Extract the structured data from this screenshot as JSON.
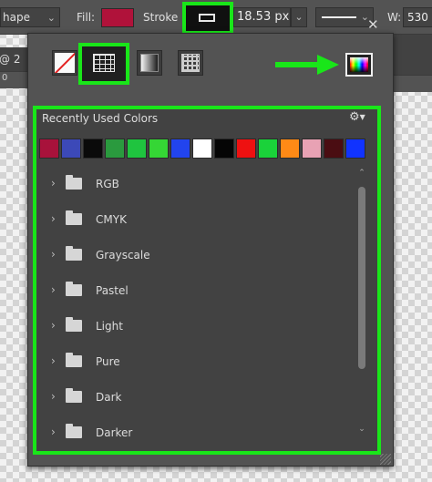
{
  "options_bar": {
    "shape_mode": "hape",
    "fill_label": "Fill:",
    "fill_color": "#b0123a",
    "stroke_label": "Stroke",
    "stroke_width": "18.53 px",
    "w_label": "W:",
    "w_value": "530"
  },
  "document": {
    "tab_text": "@ 2",
    "ruler_tick": "0"
  },
  "panel": {
    "modes": [
      {
        "name": "No Color",
        "icon": "no-color-icon"
      },
      {
        "name": "Solid Color",
        "icon": "swatch-grid-icon",
        "selected": true
      },
      {
        "name": "Gradient",
        "icon": "gradient-icon"
      },
      {
        "name": "Pattern",
        "icon": "pattern-icon"
      }
    ],
    "color_picker_icon": "color-picker-icon",
    "close_icon": "close-icon",
    "recently_used_label": "Recently Used Colors",
    "settings_icon": "gear-icon",
    "recent_colors": [
      "#a8123b",
      "#3c49b8",
      "#0a0a0a",
      "#2a9a3e",
      "#1fc43f",
      "#35d635",
      "#2244ee",
      "#ffffff",
      "#050505",
      "#ee1111",
      "#1ad23a",
      "#ff8a16",
      "#e8a2b4",
      "#4a0d12",
      "#1133ff"
    ],
    "folders": [
      {
        "label": "RGB"
      },
      {
        "label": "CMYK"
      },
      {
        "label": "Grayscale"
      },
      {
        "label": "Pastel"
      },
      {
        "label": "Light"
      },
      {
        "label": "Pure"
      },
      {
        "label": "Dark"
      },
      {
        "label": "Darker"
      }
    ]
  },
  "highlight_color": "#19e619"
}
